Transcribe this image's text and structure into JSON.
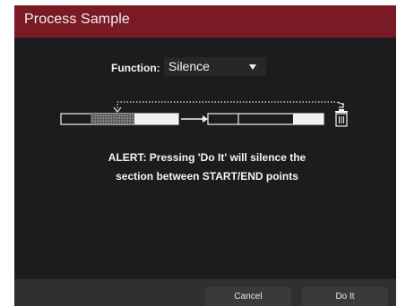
{
  "dialog": {
    "title": "Process Sample",
    "function_label": "Function:",
    "function_value": "Silence",
    "alert_line1": "ALERT: Pressing 'Do It' will silence the",
    "alert_line2": "section between START/END points",
    "cancel_label": "Cancel",
    "doit_label": "Do It"
  },
  "colors": {
    "titlebar": "#7a1a24",
    "background": "#1c1c1c",
    "footer": "#303030",
    "button": "#3a3a3a"
  },
  "icons": [
    "dropdown-caret-icon",
    "arrow-right-icon",
    "trash-icon",
    "return-arrow-icon"
  ]
}
